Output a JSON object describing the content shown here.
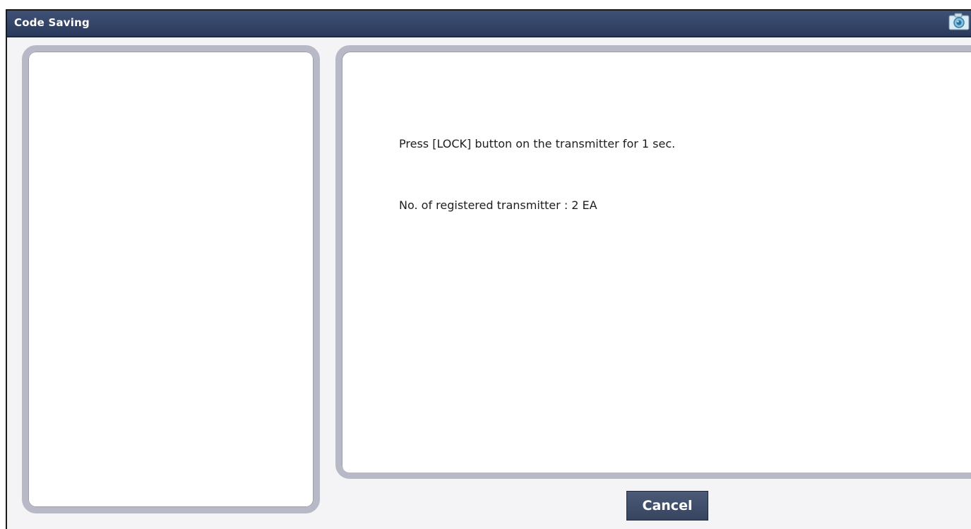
{
  "window": {
    "title": "Code Saving",
    "camera_icon": "camera-icon"
  },
  "main": {
    "instruction": "Press [LOCK] button on the transmitter for 1 sec.",
    "registered_count": "No. of registered transmitter : 2 EA"
  },
  "footer": {
    "cancel_label": "Cancel"
  },
  "colors": {
    "titlebar": "#2f3f62",
    "panel_border": "#b7bac6",
    "button": "#3f4d6a"
  }
}
